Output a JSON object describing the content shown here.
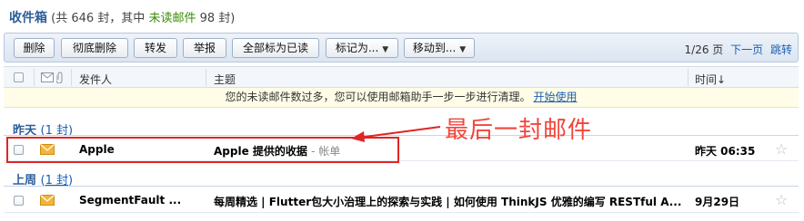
{
  "header": {
    "title": "收件箱",
    "summary_prefix": "(共 646 封，其中",
    "unread_label": "未读邮件",
    "summary_suffix": "98 封)"
  },
  "toolbar": {
    "delete": "删除",
    "delete_perm": "彻底删除",
    "forward": "转发",
    "report": "举报",
    "mark_all_read": "全部标为已读",
    "mark_as": "标记为...",
    "move_to": "移动到...",
    "page_info": "1/26 页",
    "next_page": "下一页",
    "jump": "跳转"
  },
  "columns": {
    "sender": "发件人",
    "subject": "主题",
    "time": "时间↓"
  },
  "notice": {
    "text": "您的未读邮件数过多，您可以使用邮箱助手一步一步进行清理。",
    "link": "开始使用"
  },
  "groups": [
    {
      "label": "昨天",
      "count": "1 封",
      "rows": [
        {
          "sender": "Apple",
          "subject": "Apple 提供的收据",
          "tag": "- 帐单",
          "time": "昨天 06:35"
        }
      ]
    },
    {
      "label": "上周",
      "count": "1 封",
      "rows": [
        {
          "sender": "SegmentFault ...",
          "subject": "每周精选 | Flutter包大小治理上的探索与实践 | 如何使用 ThinkJS 优雅的编写 RESTful A...",
          "tag": "",
          "time": "9月29日"
        }
      ]
    }
  ],
  "annotation": {
    "text": "最后一封邮件",
    "color": "#f0453b"
  },
  "colors": {
    "accent": "#2c5d9a",
    "link": "#1b5fb3",
    "unread_green": "#3a8e00",
    "envelope": "#f2b43a"
  }
}
